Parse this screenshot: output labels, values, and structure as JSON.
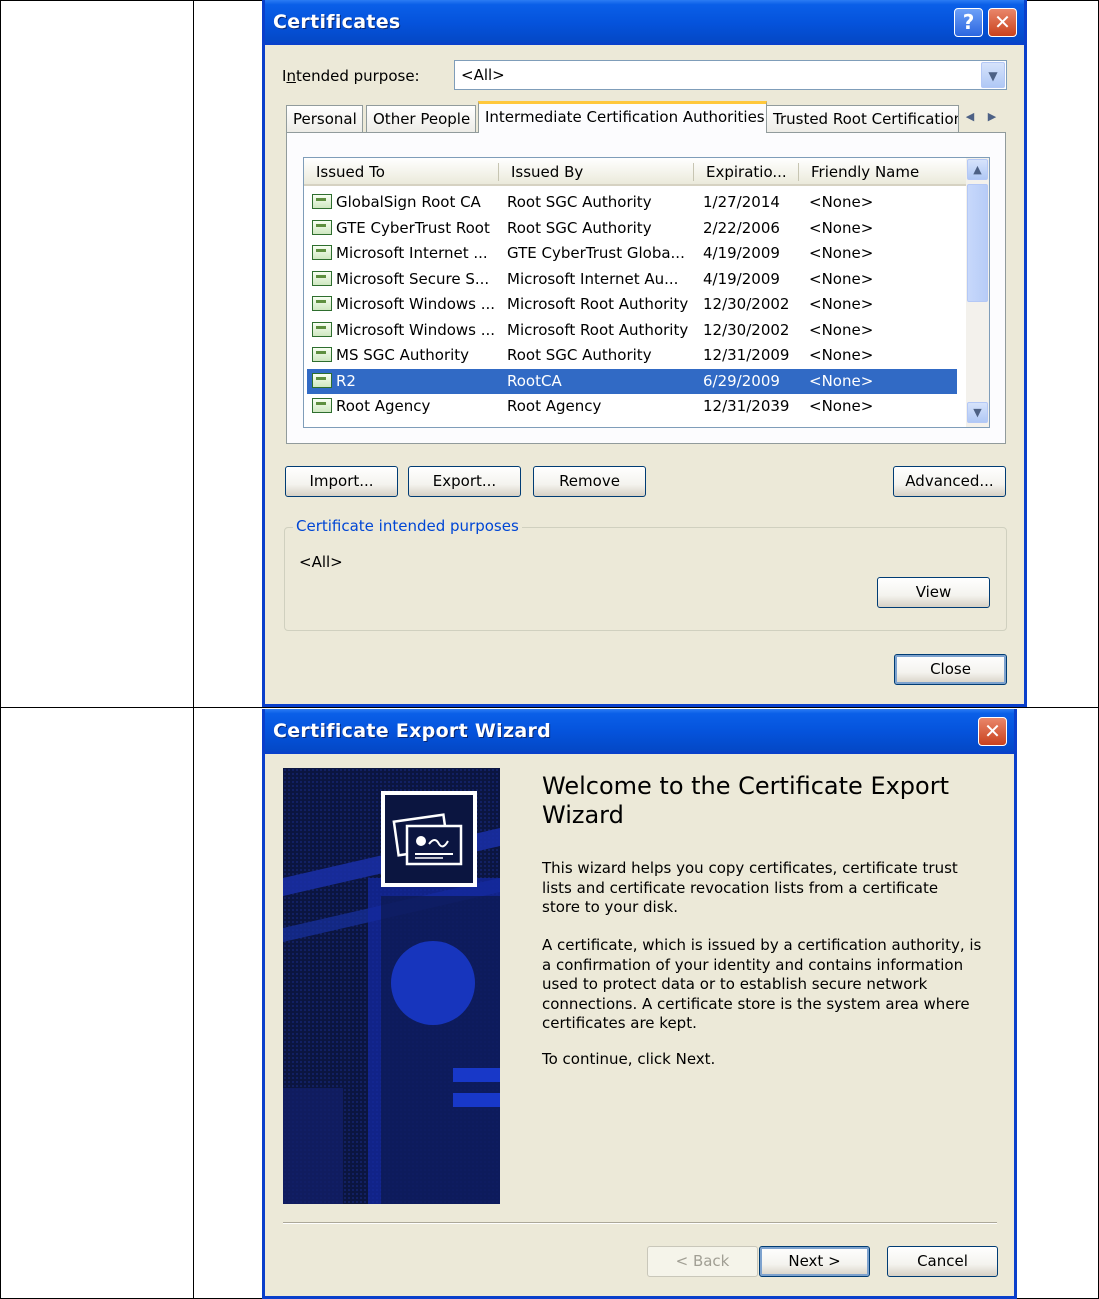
{
  "certificates": {
    "title": "Certificates",
    "intended_purpose_label": "Intended purpose:",
    "intended_purpose_value": "<All>",
    "tabs": [
      "Personal",
      "Other People",
      "Intermediate Certification Authorities",
      "Trusted Root Certification"
    ],
    "columns": [
      "Issued To",
      "Issued By",
      "Expiratio...",
      "Friendly Name"
    ],
    "rows": [
      {
        "issued_to": "GlobalSign Root CA",
        "issued_by": "Root SGC Authority",
        "expiration": "1/27/2014",
        "friendly": "<None>"
      },
      {
        "issued_to": "GTE CyberTrust Root",
        "issued_by": "Root SGC Authority",
        "expiration": "2/22/2006",
        "friendly": "<None>"
      },
      {
        "issued_to": "Microsoft Internet ...",
        "issued_by": "GTE CyberTrust Globa...",
        "expiration": "4/19/2009",
        "friendly": "<None>"
      },
      {
        "issued_to": "Microsoft Secure S...",
        "issued_by": "Microsoft Internet Au...",
        "expiration": "4/19/2009",
        "friendly": "<None>"
      },
      {
        "issued_to": "Microsoft Windows ...",
        "issued_by": "Microsoft Root Authority",
        "expiration": "12/30/2002",
        "friendly": "<None>"
      },
      {
        "issued_to": "Microsoft Windows ...",
        "issued_by": "Microsoft Root Authority",
        "expiration": "12/30/2002",
        "friendly": "<None>"
      },
      {
        "issued_to": "MS SGC Authority",
        "issued_by": "Root SGC Authority",
        "expiration": "12/31/2009",
        "friendly": "<None>"
      },
      {
        "issued_to": "R2",
        "issued_by": "RootCA",
        "expiration": "6/29/2009",
        "friendly": "<None>"
      },
      {
        "issued_to": "Root Agency",
        "issued_by": "Root Agency",
        "expiration": "12/31/2039",
        "friendly": "<None>"
      }
    ],
    "selected_row": 7,
    "buttons": {
      "import": "Import...",
      "export": "Export...",
      "remove": "Remove",
      "advanced": "Advanced...",
      "view": "View",
      "close": "Close"
    },
    "purposes_title": "Certificate intended purposes",
    "purposes_value": "<All>"
  },
  "wizard": {
    "title": "Certificate Export Wizard",
    "heading_line1": "Welcome to the Certificate Export",
    "heading_line2": "Wizard",
    "para1": [
      "This wizard helps you copy certificates, certificate trust",
      "lists and certificate revocation lists from a certificate",
      "store to your disk."
    ],
    "para2": [
      "A certificate, which is issued by a certification authority, is",
      "a confirmation of your identity and contains information",
      "used to protect data or to establish secure network",
      "connections. A certificate store is the system area where",
      "certificates are kept."
    ],
    "para3": "To continue, click Next.",
    "buttons": {
      "back": "< Back",
      "next": "Next >",
      "cancel": "Cancel"
    }
  },
  "colors": {
    "titlebar": "#0553DC",
    "selection": "#316AC5",
    "dialog_bg": "#ECE9D8",
    "group_title": "#0046D5"
  }
}
